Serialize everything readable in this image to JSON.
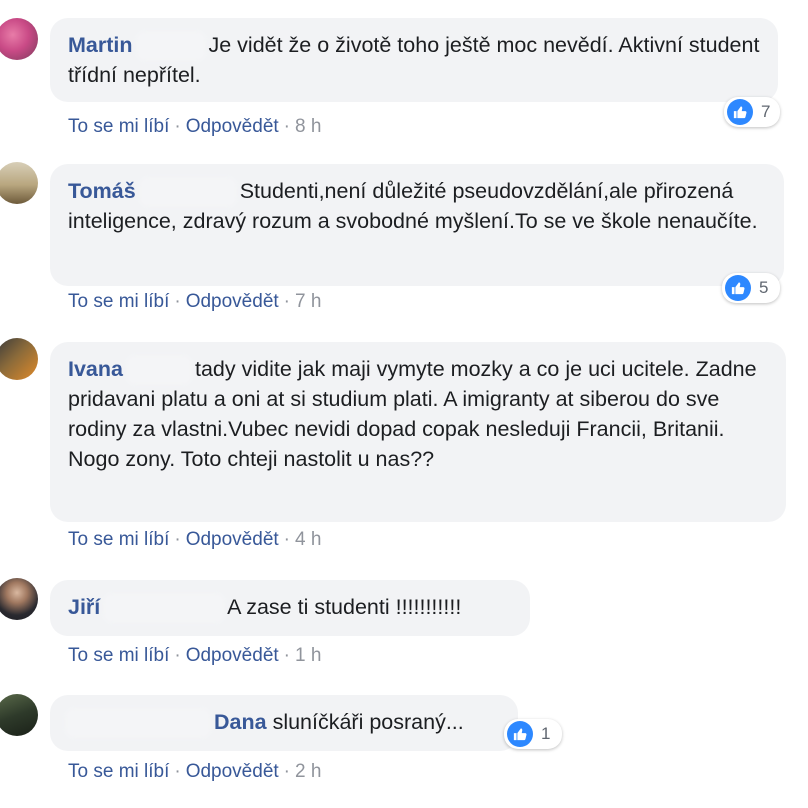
{
  "comments": [
    {
      "author": "Martin",
      "text": "Je vidět že o životě toho ještě moc nevědí. Aktivní student třídní nepřítel.",
      "like_label": "To se mi líbí",
      "reply_label": "Odpovědět",
      "time": "8 h",
      "reactions": "7"
    },
    {
      "author": "Tomáš",
      "text": "Studenti,není důležité pseudovzdělání,ale přirozená inteligence, zdravý rozum a svobodné myšlení.To se ve škole nenaučíte.",
      "like_label": "To se mi líbí",
      "reply_label": "Odpovědět",
      "time": "7 h",
      "reactions": "5"
    },
    {
      "author": "Ivana",
      "text": "tady vidite jak maji vymyte mozky a co je uci ucitele. Zadne pridavani platu a oni at si studium plati. A imigranty at siberou do sve rodiny za vlastni.Vubec nevidi dopad copak nesleduji Francii, Britanii. Nogo zony. Toto chteji nastolit u nas??",
      "like_label": "To se mi líbí",
      "reply_label": "Odpovědět",
      "time": "4 h"
    },
    {
      "author": "Jiří",
      "text": "A zase ti studenti !!!!!!!!!!!",
      "like_label": "To se mi líbí",
      "reply_label": "Odpovědět",
      "time": "1 h"
    },
    {
      "author": "Dana",
      "text": "sluníčkáři posraný...",
      "like_label": "To se mi líbí",
      "reply_label": "Odpovědět",
      "time": "2 h",
      "reactions": "1"
    }
  ],
  "separator": "·",
  "colors": {
    "link": "#385898",
    "bubble": "#f2f3f5",
    "like_blue": "#2d88ff",
    "meta": "#90949c"
  },
  "icons": [
    "avatar",
    "like-icon"
  ]
}
